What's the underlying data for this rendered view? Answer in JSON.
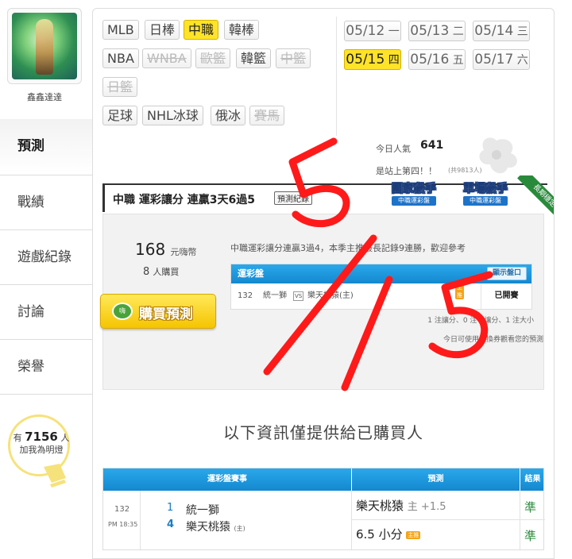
{
  "profile": {
    "username": "鑫鑫達達"
  },
  "nav": {
    "items": [
      {
        "label": "預測"
      },
      {
        "label": "戰績"
      },
      {
        "label": "遊戲紀錄"
      },
      {
        "label": "討論"
      },
      {
        "label": "榮譽"
      }
    ],
    "active": "預測"
  },
  "bulb": {
    "prefix": "有",
    "count": "7156",
    "suffix": "人",
    "line2": "加我為明燈"
  },
  "sports": {
    "row1": [
      "MLB",
      "日棒",
      "中職",
      "韓棒"
    ],
    "row2": [
      "NBA",
      "WNBA",
      "歐籃",
      "韓籃",
      "中籃"
    ],
    "row3": [
      "日籃"
    ],
    "row4": [
      "足球",
      "NHL冰球",
      "俄冰",
      "賽馬"
    ],
    "selected": "中職",
    "disabled": [
      "WNBA",
      "歐籃",
      "中籃",
      "日籃",
      "賽馬"
    ]
  },
  "dates": [
    {
      "date": "05/12",
      "day": "一"
    },
    {
      "date": "05/13",
      "day": "二"
    },
    {
      "date": "05/14",
      "day": "三"
    },
    {
      "date": "05/15",
      "day": "四"
    },
    {
      "date": "05/16",
      "day": "五"
    },
    {
      "date": "05/17",
      "day": "六"
    }
  ],
  "selected_date": "05/15",
  "popularity": {
    "label": "今日人氣",
    "count": "641",
    "rank_text": "是站上第四！！",
    "rank_small": "(共9813人)"
  },
  "prediction": {
    "title": "中職 運彩讓分 連贏3天6過5",
    "tag": "預測紀錄",
    "badges": [
      {
        "title": "國家殺手",
        "sub": "中職運彩盤"
      },
      {
        "title": "單場殺手",
        "sub": "中職運彩盤"
      }
    ],
    "ribbon": "長期穩定",
    "price": "168",
    "price_unit": "元嗨幣",
    "buyers": "8",
    "buyers_unit": "人購買",
    "buy_label": "購買預測",
    "buy_icon_text": "嗨",
    "description": "中職運彩讓分連贏3過4，本季主推最長記錄9連勝，歡迎參考",
    "table_title": "運彩盤",
    "open_btn": "顯示盤口",
    "row": {
      "id": "132",
      "team1": "統一獅",
      "vs": "VS",
      "team2": "樂天桃猿(主)",
      "host": "主推",
      "status": "已開賽"
    },
    "stats": "1 注讓分、0 注不讓分、1 注大小",
    "note": "今日可使用兌換券觀看您的預測"
  },
  "info_line": "以下資訊僅提供給已購買人",
  "results": {
    "headers": {
      "game": "運彩盤賽事",
      "pred": "預測",
      "result": "結果"
    },
    "game": {
      "id": "132",
      "time": "PM 18:35",
      "score1": "1",
      "team1": "統一獅",
      "score2": "4",
      "team2": "樂天桃猿",
      "team2_tag": "(主)"
    },
    "predictions": [
      {
        "pick": "樂天桃猿",
        "detail": "主 +1.5",
        "result": "準"
      },
      {
        "pick": "6.5 小分",
        "host": "主推",
        "result": "準"
      }
    ]
  },
  "overlay_colors": {
    "scribble": "#ff1a1a"
  }
}
